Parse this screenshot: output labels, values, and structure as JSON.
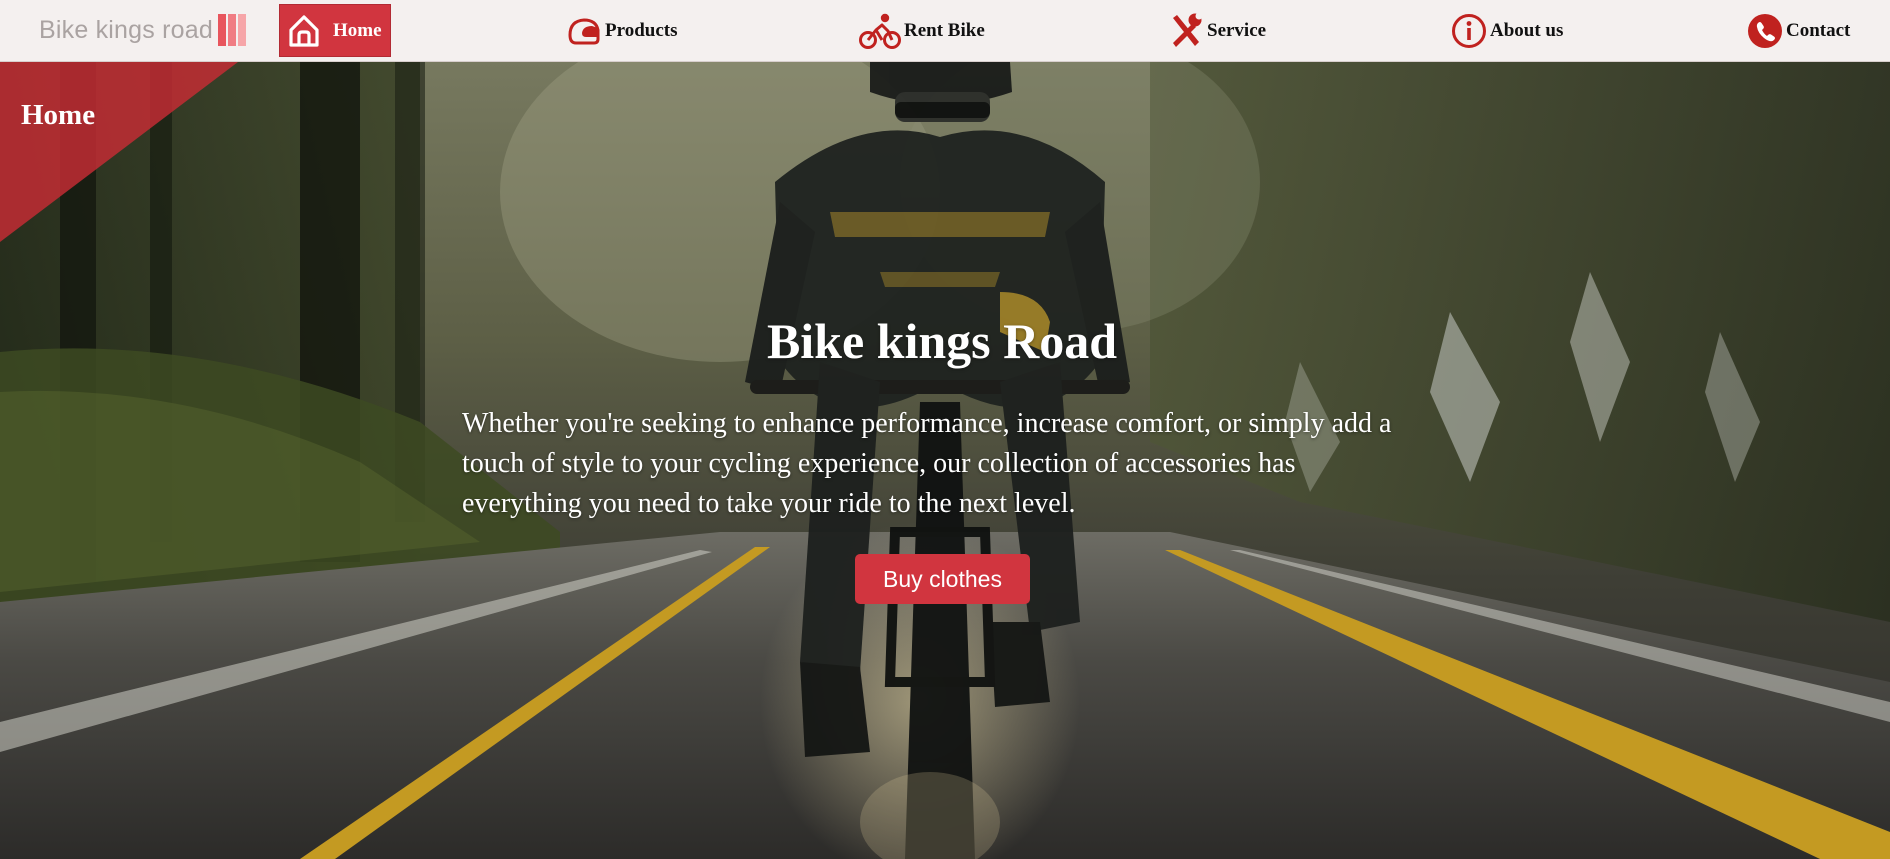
{
  "brand": {
    "name": "Bike kings road",
    "logo_colors": [
      "#e8555d",
      "#f07c83",
      "#f6a5a8"
    ]
  },
  "nav": {
    "items": [
      {
        "label": "Home",
        "icon": "home-icon",
        "active": true
      },
      {
        "label": "Products",
        "icon": "helmet-icon",
        "active": false
      },
      {
        "label": "Rent Bike",
        "icon": "cyclist-icon",
        "active": false
      },
      {
        "label": "Service",
        "icon": "tools-icon",
        "active": false
      },
      {
        "label": "About us",
        "icon": "info-icon",
        "active": false
      },
      {
        "label": "Contact",
        "icon": "phone-icon",
        "active": false
      }
    ]
  },
  "hero": {
    "corner_label": "Home",
    "title": "Bike kings Road",
    "description": "Whether you're seeking to enhance performance, increase comfort, or simply add a touch of style to your cycling experience, our collection of accessories has everything you need to take your ride to the next level.",
    "cta_label": "Buy clothes",
    "background": "photo of a cyclist on a wet forest road"
  },
  "colors": {
    "accent": "#d1353f",
    "nav_background": "#f4f0ef",
    "brand_text": "#aaa3a2",
    "icon_red": "#c0221f"
  }
}
